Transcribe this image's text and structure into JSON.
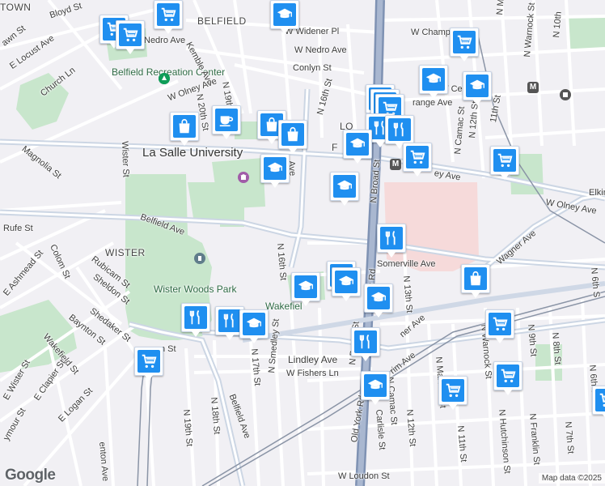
{
  "map": {
    "attribution": "Map data ©2025",
    "logo": "Google",
    "labels": {
      "neighborhoods": {
        "belfield": "BELFIELD",
        "wister": "WISTER",
        "logan_partial": "TOWN",
        "fern_rock_partial": "F",
        "fern_rock_partial2": "RN",
        "logan2": "LO",
        "logan3": "GAN"
      },
      "places": {
        "la_salle": "La Salle University",
        "belfield_rec": "Belfield Recreation Center",
        "wister_woods": "Wister Woods Park",
        "transportation_center": "T Center",
        "wakefield": "Wakefiel",
        "park_partial": "ark"
      },
      "streets": {
        "bloyd": "Bloyd St",
        "e_locust": "E Locust Ave",
        "lawn": "awn St",
        "church": "Church Ln",
        "nedro_w": "Nedro Ave",
        "kemble": "Kemble Ave",
        "n_20th": "N 20th St",
        "n_19th_top": "N 19th",
        "widener": "W Widener Pl",
        "nedro_mid": "W Nedro Ave",
        "conlyn": "Conlyn St",
        "w_olney_left": "W Olney Ave",
        "w_champ": "W Champ",
        "n_16th_top": "N 16th St",
        "magnolia": "Magnolia St",
        "wister_st": "Wister St",
        "belfield_ave": "Belfield Ave",
        "rufe": "Rufe St",
        "colom": "Colom St",
        "ashmead": "E Ashmead St",
        "rubicam": "Rubicam St",
        "sheldon": "Sheldon St",
        "baynton": "Baynton St",
        "shedaker": "Shedaker St",
        "wakefield_st": "Wakefield St",
        "e_wister": "E Wister St",
        "e_clapier": "E Clapier St",
        "e_logan": "E Logan St",
        "seymour": "ymour St",
        "n_broad": "N Broad St",
        "old_york": "Old York Rd",
        "old_york_lower": "Old York Rd",
        "somerville": "Somerville Ave",
        "w_olney_right": "W Olney Ave",
        "olney_partial": "ey Ave",
        "wagner": "Wagner Ave",
        "lindley": "Lindley Ave",
        "w_fishers": "W Fishers Ln",
        "n_16th": "N 16th St",
        "n_17th": "N 17th St",
        "n_smedley": "N Smedley St",
        "n_18th": "N 18th St",
        "n_19th": "N 19th St",
        "belfield_lower": "Belfield Ave",
        "fenton": "enton Ave",
        "n_13th": "N 13th St",
        "n_12th_lower": "N 12th St",
        "n_11th_lower": "N 11th St",
        "n_camac_lower": "N Camac St",
        "n_marvine_lower": "N Marvine St",
        "n_warnock": "N Warnock St",
        "n_marvine_top": "N Marvine St",
        "n_camac_top": "N Camac St",
        "n_12th_top": "N 12th St",
        "n_11th_top": "11th St",
        "n_warnock_top": "N Warnock St",
        "n_10th": "N 10th",
        "n_9th": "N 9th St",
        "n_8th": "N 8th St",
        "n_7th": "N 7th St",
        "n_6th": "N 6th St",
        "n_6th_r": "N 6th S",
        "n_franklin": "N Franklin St",
        "hutchinson": "N Hutchinson St",
        "hutchin_partial": "utchin",
        "carlisle": "Carlisle St",
        "lousden": "W Loudon St",
        "mid_st": "St",
        "n_19th_2": "N 19th St",
        "w_orange": "range Ave",
        "elkins": "Elkin",
        "n_17th_top": "N 17th",
        "ork_rd": "York Rd",
        "road_st": "rd St",
        "ner_ave": "ner Ave",
        "rim_ave": "rim Ave",
        "ve": "ve",
        "n_smedley_top": "Ave",
        "in_st": "n St",
        "n_warn_lower": "N Warnock St",
        "n_ste": "St"
      }
    },
    "markers": [
      {
        "type": "grocery",
        "name": "shopping-cart-icon"
      },
      {
        "type": "school",
        "name": "graduation-cap-icon"
      },
      {
        "type": "store",
        "name": "shopping-bag-icon"
      },
      {
        "type": "cafe",
        "name": "coffee-cup-icon"
      },
      {
        "type": "restaurant",
        "name": "fork-knife-icon"
      }
    ],
    "colors": {
      "background": "#f1f0f4",
      "park": "#c8e6cc",
      "hospital": "#f6dada",
      "road": "#ffffff",
      "arterial": "#ccd6e4",
      "rail": "#8a94a6",
      "marker_blue": "#1f8ff0"
    }
  }
}
